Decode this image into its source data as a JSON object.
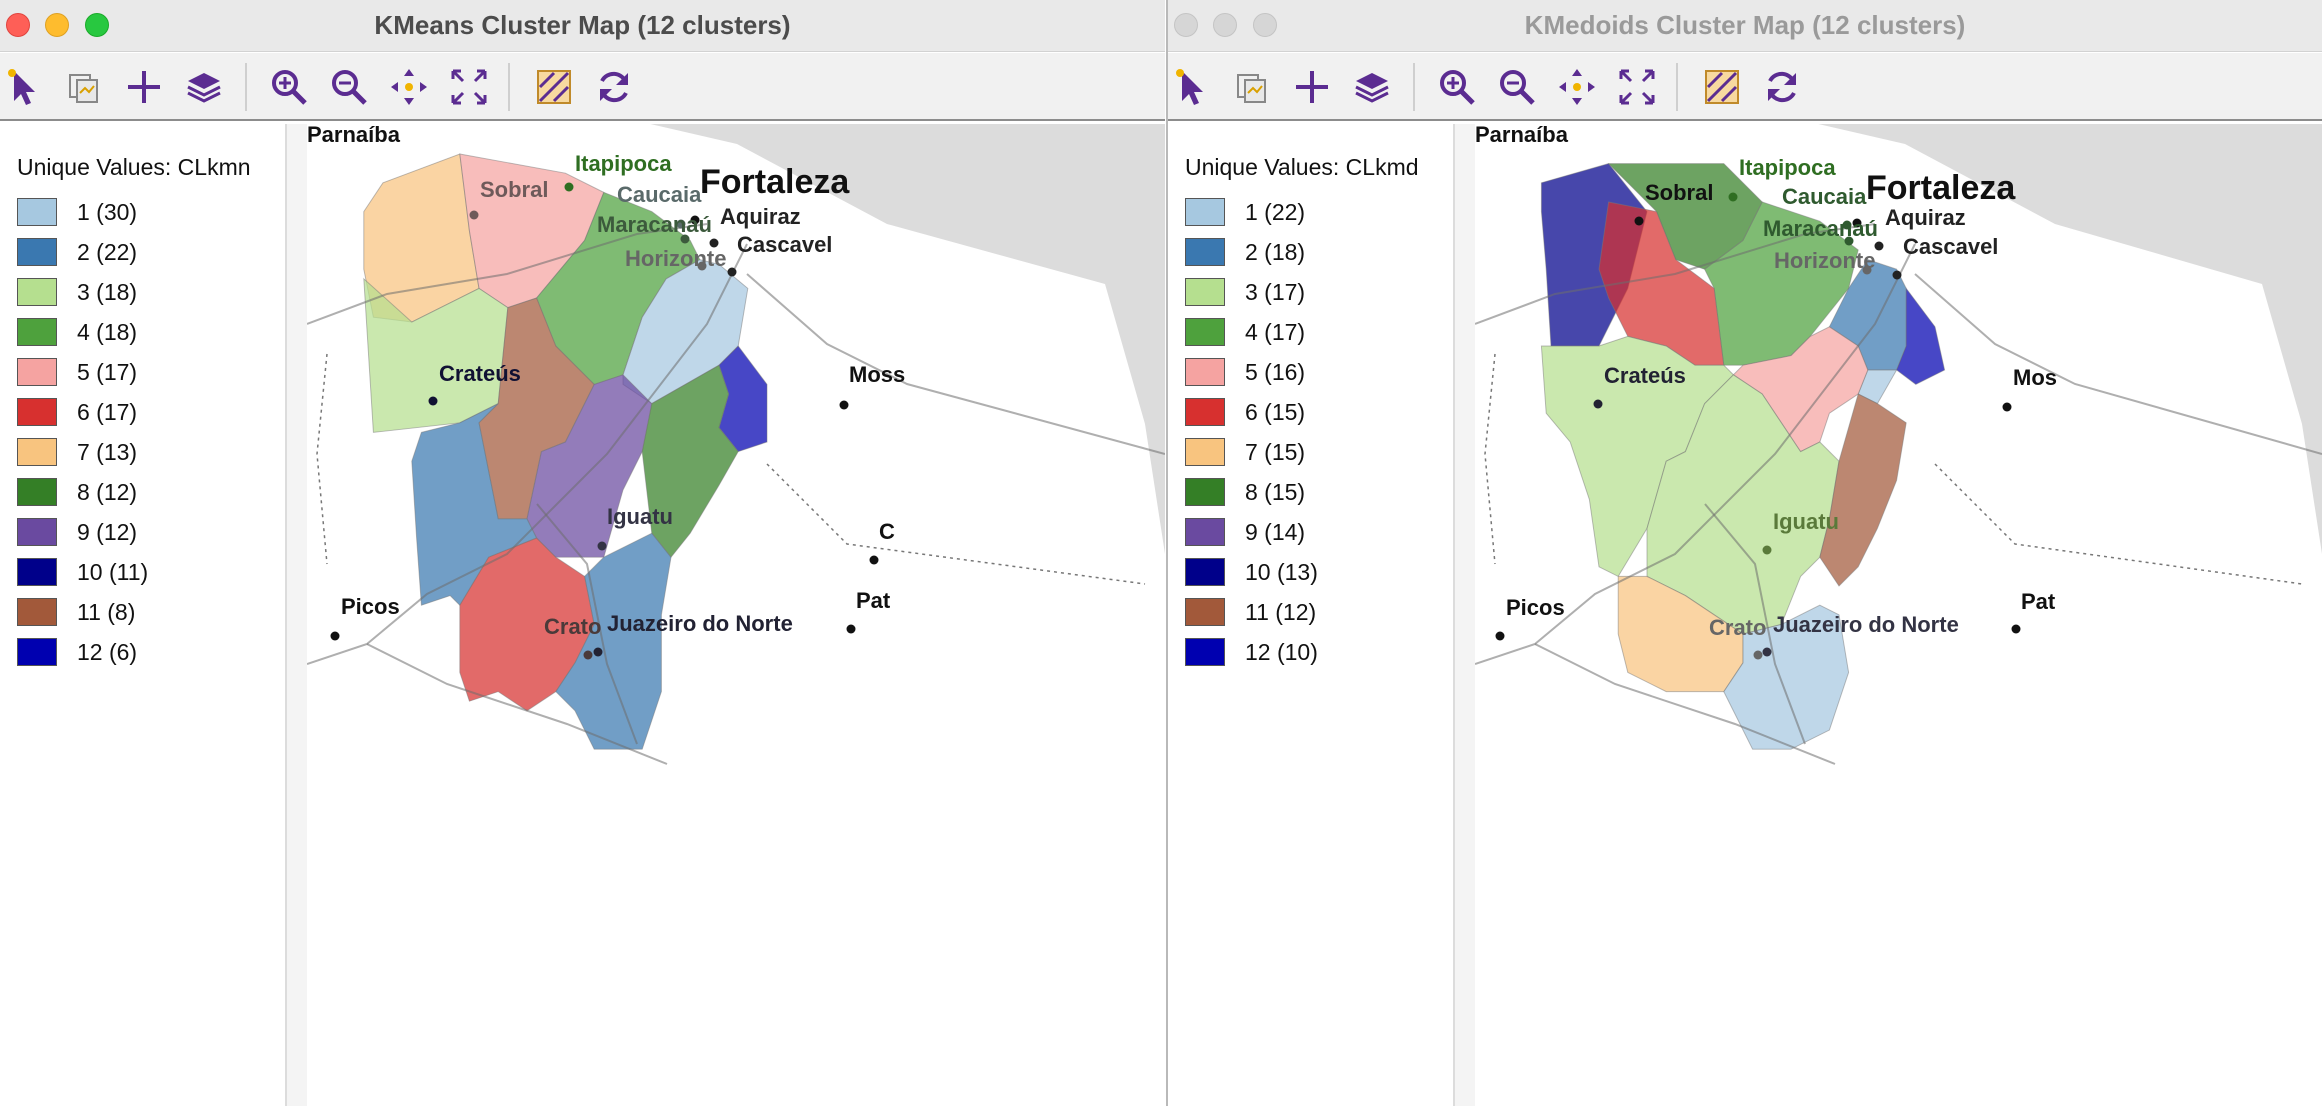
{
  "windows": [
    {
      "id": "kmeans",
      "title": "KMeans Cluster Map (12 clusters)",
      "active": true,
      "legend_title": "Unique Values: CLkmn",
      "legend": [
        {
          "label": "1 (30)",
          "color": "#a6c8e0"
        },
        {
          "label": "2 (22)",
          "color": "#3a78b0"
        },
        {
          "label": "3 (18)",
          "color": "#b5df8f"
        },
        {
          "label": "4 (18)",
          "color": "#4ea13d"
        },
        {
          "label": "5 (17)",
          "color": "#f5a3a1"
        },
        {
          "label": "6 (17)",
          "color": "#d7302f"
        },
        {
          "label": "7 (13)",
          "color": "#f8c47f"
        },
        {
          "label": "8 (12)",
          "color": "#347f26"
        },
        {
          "label": "9 (12)",
          "color": "#6a4aa0"
        },
        {
          "label": "10 (11)",
          "color": "#00008a"
        },
        {
          "label": "11 (8)",
          "color": "#a2593a"
        },
        {
          "label": "12 (6)",
          "color": "#0000b0"
        }
      ],
      "cities": [
        {
          "name": "Parnaíba",
          "size": "small",
          "color": "#111111"
        },
        {
          "name": "Itapipoca",
          "size": "small",
          "color": "#2f6e22"
        },
        {
          "name": "Sobral",
          "size": "small",
          "color": "#6e5a5a"
        },
        {
          "name": "Caucaia",
          "size": "small",
          "color": "#5a6a6a"
        },
        {
          "name": "Fortaleza",
          "size": "large",
          "color": "#111111"
        },
        {
          "name": "Maracanaú",
          "size": "small",
          "color": "#3c5a3c"
        },
        {
          "name": "Aquiraz",
          "size": "small",
          "color": "#222222"
        },
        {
          "name": "Cascavel",
          "size": "small",
          "color": "#222222"
        },
        {
          "name": "Horizonte",
          "size": "small",
          "color": "#666666"
        },
        {
          "name": "Crateús",
          "size": "small",
          "color": "#111133"
        },
        {
          "name": "Moss",
          "size": "small",
          "color": "#111111"
        },
        {
          "name": "Iguatu",
          "size": "small",
          "color": "#333344"
        },
        {
          "name": "Picos",
          "size": "small",
          "color": "#111111"
        },
        {
          "name": "Crato",
          "size": "small",
          "color": "#4a3a3a"
        },
        {
          "name": "Juazeiro do Norte",
          "size": "small",
          "color": "#222233"
        },
        {
          "name": "Pat",
          "size": "small",
          "color": "#111111"
        },
        {
          "name": "C",
          "size": "small",
          "color": "#111111"
        }
      ]
    },
    {
      "id": "kmedoids",
      "title": "KMedoids Cluster Map (12 clusters)",
      "active": false,
      "legend_title": "Unique Values: CLkmd",
      "legend": [
        {
          "label": "1 (22)",
          "color": "#a6c8e0"
        },
        {
          "label": "2 (18)",
          "color": "#3a78b0"
        },
        {
          "label": "3 (17)",
          "color": "#b5df8f"
        },
        {
          "label": "4 (17)",
          "color": "#4ea13d"
        },
        {
          "label": "5 (16)",
          "color": "#f5a3a1"
        },
        {
          "label": "6 (15)",
          "color": "#d7302f"
        },
        {
          "label": "7 (15)",
          "color": "#f8c47f"
        },
        {
          "label": "8 (15)",
          "color": "#347f26"
        },
        {
          "label": "9 (14)",
          "color": "#6a4aa0"
        },
        {
          "label": "10 (13)",
          "color": "#00008a"
        },
        {
          "label": "11 (12)",
          "color": "#a2593a"
        },
        {
          "label": "12 (10)",
          "color": "#0000b0"
        }
      ],
      "cities": [
        {
          "name": "Parnaíba",
          "size": "small",
          "color": "#111111"
        },
        {
          "name": "Itapipoca",
          "size": "small",
          "color": "#2f6e22"
        },
        {
          "name": "Sobral",
          "size": "small",
          "color": "#111111"
        },
        {
          "name": "Caucaia",
          "size": "small",
          "color": "#2f5a2f"
        },
        {
          "name": "Fortaleza",
          "size": "large",
          "color": "#111111"
        },
        {
          "name": "Maracanaú",
          "size": "small",
          "color": "#2f5a2f"
        },
        {
          "name": "Aquiraz",
          "size": "small",
          "color": "#222222"
        },
        {
          "name": "Cascavel",
          "size": "small",
          "color": "#222222"
        },
        {
          "name": "Horizonte",
          "size": "small",
          "color": "#666666"
        },
        {
          "name": "Crateús",
          "size": "small",
          "color": "#222233"
        },
        {
          "name": "Mos",
          "size": "small",
          "color": "#111111"
        },
        {
          "name": "Iguatu",
          "size": "small",
          "color": "#5a7a3a"
        },
        {
          "name": "Picos",
          "size": "small",
          "color": "#111111"
        },
        {
          "name": "Crato",
          "size": "small",
          "color": "#666666"
        },
        {
          "name": "Juazeiro do Norte",
          "size": "small",
          "color": "#333344"
        },
        {
          "name": "Pat",
          "size": "small",
          "color": "#111111"
        }
      ]
    }
  ],
  "toolbar": {
    "icons": [
      "select-arrow-icon",
      "copy-map-icon",
      "add-point-icon",
      "layers-icon",
      "zoom-in-icon",
      "zoom-out-icon",
      "pan-icon",
      "full-extent-icon",
      "map-settings-icon",
      "refresh-icon"
    ]
  },
  "colors": {
    "toolbar_icon": "#5b2c91",
    "basemap_land": "#ffffff",
    "basemap_sea": "#dcdcdc"
  }
}
